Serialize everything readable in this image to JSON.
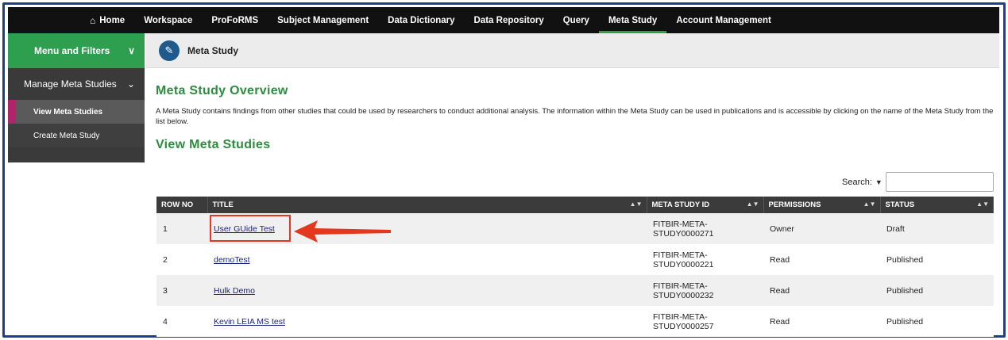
{
  "nav": {
    "home": "Home",
    "items": [
      "Workspace",
      "ProFoRMS",
      "Subject Management",
      "Data Dictionary",
      "Data Repository",
      "Query",
      "Meta Study",
      "Account Management"
    ]
  },
  "sidebar": {
    "header": "Menu and Filters",
    "section": "Manage Meta Studies",
    "links": [
      "View Meta Studies",
      "Create Meta Study"
    ]
  },
  "breadcrumb": {
    "title": "Meta Study"
  },
  "main": {
    "overview_heading": "Meta Study Overview",
    "description": "A Meta Study contains findings from other studies that could be used by researchers to conduct additional analysis. The information within the Meta Study can be used in publications and is accessible by clicking on the name of the Meta Study from the list below.",
    "view_heading": "View Meta Studies",
    "search_label": "Search:"
  },
  "table": {
    "headers": [
      "ROW NO",
      "TITLE",
      "META STUDY ID",
      "PERMISSIONS",
      "STATUS"
    ],
    "rows": [
      {
        "no": "1",
        "title": "User GUide Test",
        "id_line1": "FITBIR-META-",
        "id_line2": "STUDY0000271",
        "perm": "Owner",
        "status": "Draft"
      },
      {
        "no": "2",
        "title": "demoTest",
        "id_line1": "FITBIR-META-",
        "id_line2": "STUDY0000221",
        "perm": "Read",
        "status": "Published"
      },
      {
        "no": "3",
        "title": "Hulk Demo",
        "id_line1": "FITBIR-META-",
        "id_line2": "STUDY0000232",
        "perm": "Read",
        "status": "Published"
      },
      {
        "no": "4",
        "title": "Kevin LEIA MS test",
        "id_line1": "FITBIR-META-",
        "id_line2": "STUDY0000257",
        "perm": "Read",
        "status": "Published"
      }
    ]
  },
  "colors": {
    "accent": "#2e9e4f",
    "frame": "#1d3f8f",
    "callout": "#e3371e"
  }
}
